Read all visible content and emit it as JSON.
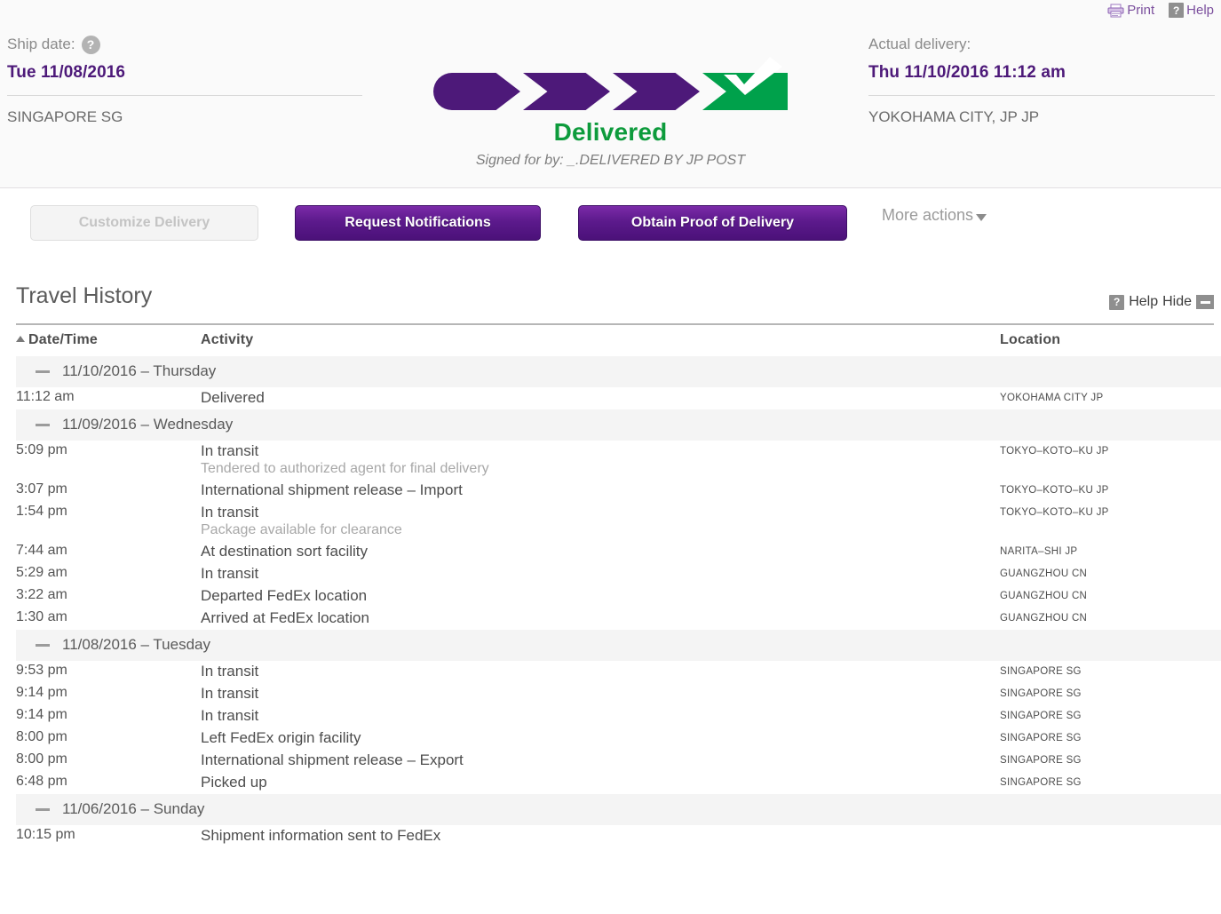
{
  "utility": {
    "print_label": "Print",
    "help_label": "Help"
  },
  "summary": {
    "ship": {
      "label": "Ship date:",
      "help_glyph": "?",
      "value": "Tue 11/08/2016",
      "location": "SINGAPORE SG"
    },
    "delivery": {
      "label": "Actual delivery:",
      "value": "Thu 11/10/2016 11:12 am",
      "location": "YOKOHAMA CITY, JP JP"
    },
    "progress": {
      "steps": [
        "step-1",
        "step-2",
        "step-3",
        "step-4-delivered"
      ],
      "completed_color": "#4d1979",
      "delivered_color": "#00a14b",
      "status": "Delivered",
      "signed_for": "Signed for by: _.DELIVERED BY JP POST"
    }
  },
  "actions": {
    "customize_delivery": "Customize Delivery",
    "request_notifications": "Request Notifications",
    "obtain_proof": "Obtain Proof of Delivery",
    "more_actions": "More actions"
  },
  "travel_history": {
    "title": "Travel History",
    "help_label": "Help",
    "help_glyph": "?",
    "hide_label": "Hide",
    "columns": {
      "datetime": "Date/Time",
      "activity": "Activity",
      "location": "Location"
    },
    "groups": [
      {
        "date": "11/10/2016 – Thursday",
        "events": [
          {
            "time": "11:12 am",
            "activity": "Delivered",
            "detail": "",
            "location": "YOKOHAMA CITY JP"
          }
        ]
      },
      {
        "date": "11/09/2016 – Wednesday",
        "events": [
          {
            "time": "5:09 pm",
            "activity": "In transit",
            "detail": "Tendered to authorized agent for final delivery",
            "location": "TOKYO–KOTO–KU JP"
          },
          {
            "time": "3:07 pm",
            "activity": "International shipment release – Import",
            "detail": "",
            "location": "TOKYO–KOTO–KU JP"
          },
          {
            "time": "1:54 pm",
            "activity": "In transit",
            "detail": "Package available for clearance",
            "location": "TOKYO–KOTO–KU JP"
          },
          {
            "time": "7:44 am",
            "activity": "At destination sort facility",
            "detail": "",
            "location": "NARITA–SHI JP"
          },
          {
            "time": "5:29 am",
            "activity": "In transit",
            "detail": "",
            "location": "GUANGZHOU CN"
          },
          {
            "time": "3:22 am",
            "activity": "Departed FedEx location",
            "detail": "",
            "location": "GUANGZHOU CN"
          },
          {
            "time": "1:30 am",
            "activity": "Arrived at FedEx location",
            "detail": "",
            "location": "GUANGZHOU CN"
          }
        ]
      },
      {
        "date": "11/08/2016 – Tuesday",
        "events": [
          {
            "time": "9:53 pm",
            "activity": "In transit",
            "detail": "",
            "location": "SINGAPORE SG"
          },
          {
            "time": "9:14 pm",
            "activity": "In transit",
            "detail": "",
            "location": "SINGAPORE SG"
          },
          {
            "time": "9:14 pm",
            "activity": "In transit",
            "detail": "",
            "location": "SINGAPORE SG"
          },
          {
            "time": "8:00 pm",
            "activity": "Left FedEx origin facility",
            "detail": "",
            "location": "SINGAPORE SG"
          },
          {
            "time": "8:00 pm",
            "activity": "International shipment release – Export",
            "detail": "",
            "location": "SINGAPORE SG"
          },
          {
            "time": "6:48 pm",
            "activity": "Picked up",
            "detail": "",
            "location": "SINGAPORE SG"
          }
        ]
      },
      {
        "date": "11/06/2016 – Sunday",
        "events": [
          {
            "time": "10:15 pm",
            "activity": "Shipment information sent to FedEx",
            "detail": "",
            "location": ""
          }
        ]
      }
    ]
  }
}
